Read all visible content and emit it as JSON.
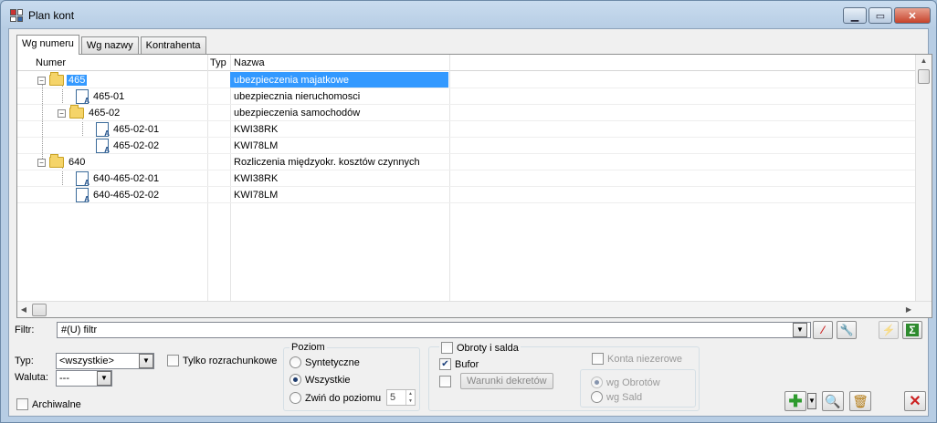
{
  "window": {
    "title": "Plan kont"
  },
  "tabs": [
    {
      "label": "Wg numeru"
    },
    {
      "label": "Wg nazwy"
    },
    {
      "label": "Kontrahenta"
    }
  ],
  "grid": {
    "columns": {
      "numer": "Numer",
      "typ": "Typ",
      "nazwa": "Nazwa"
    },
    "rows": [
      {
        "numer": "465",
        "typ": "",
        "nazwa": "ubezpieczenia majatkowe",
        "level": 0,
        "kind": "folder"
      },
      {
        "numer": "465-01",
        "typ": "",
        "nazwa": "ubezpiecznia nieruchomosci",
        "level": 1,
        "kind": "account"
      },
      {
        "numer": "465-02",
        "typ": "",
        "nazwa": "ubezpieczenia samochodów",
        "level": 1,
        "kind": "folder"
      },
      {
        "numer": "465-02-01",
        "typ": "",
        "nazwa": "KWI38RK",
        "level": 2,
        "kind": "account"
      },
      {
        "numer": "465-02-02",
        "typ": "",
        "nazwa": "KWI78LM",
        "level": 2,
        "kind": "account"
      },
      {
        "numer": "640",
        "typ": "",
        "nazwa": "Rozliczenia międzyokr. kosztów czynnych",
        "level": 0,
        "kind": "folder"
      },
      {
        "numer": "640-465-02-01",
        "typ": "",
        "nazwa": "KWI38RK",
        "level": 1,
        "kind": "account"
      },
      {
        "numer": "640-465-02-02",
        "typ": "",
        "nazwa": "KWI78LM",
        "level": 1,
        "kind": "account"
      }
    ]
  },
  "filter": {
    "label": "Filtr:",
    "value": "#(U) filtr"
  },
  "options": {
    "typ_label": "Typ:",
    "typ_value": "<wszystkie>",
    "waluta_label": "Waluta:",
    "waluta_value": "---",
    "tylko_rozrachunkowe": "Tylko rozrachunkowe",
    "archiwalne": "Archiwalne"
  },
  "poziom": {
    "title": "Poziom",
    "syntetyczne": "Syntetyczne",
    "wszystkie": "Wszystkie",
    "zwin": "Zwiń do poziomu",
    "zwin_value": "5"
  },
  "obroty": {
    "title": "Obroty i salda",
    "bufor": "Bufor",
    "warunki": "Warunki dekretów",
    "konta_niezerowe": "Konta niezerowe",
    "wg_obrotow": "wg Obrotów",
    "wg_sald": "wg Sald"
  },
  "colors": {
    "selection": "#3399ff",
    "accent": "#2e8b2e",
    "danger": "#cc2222"
  }
}
